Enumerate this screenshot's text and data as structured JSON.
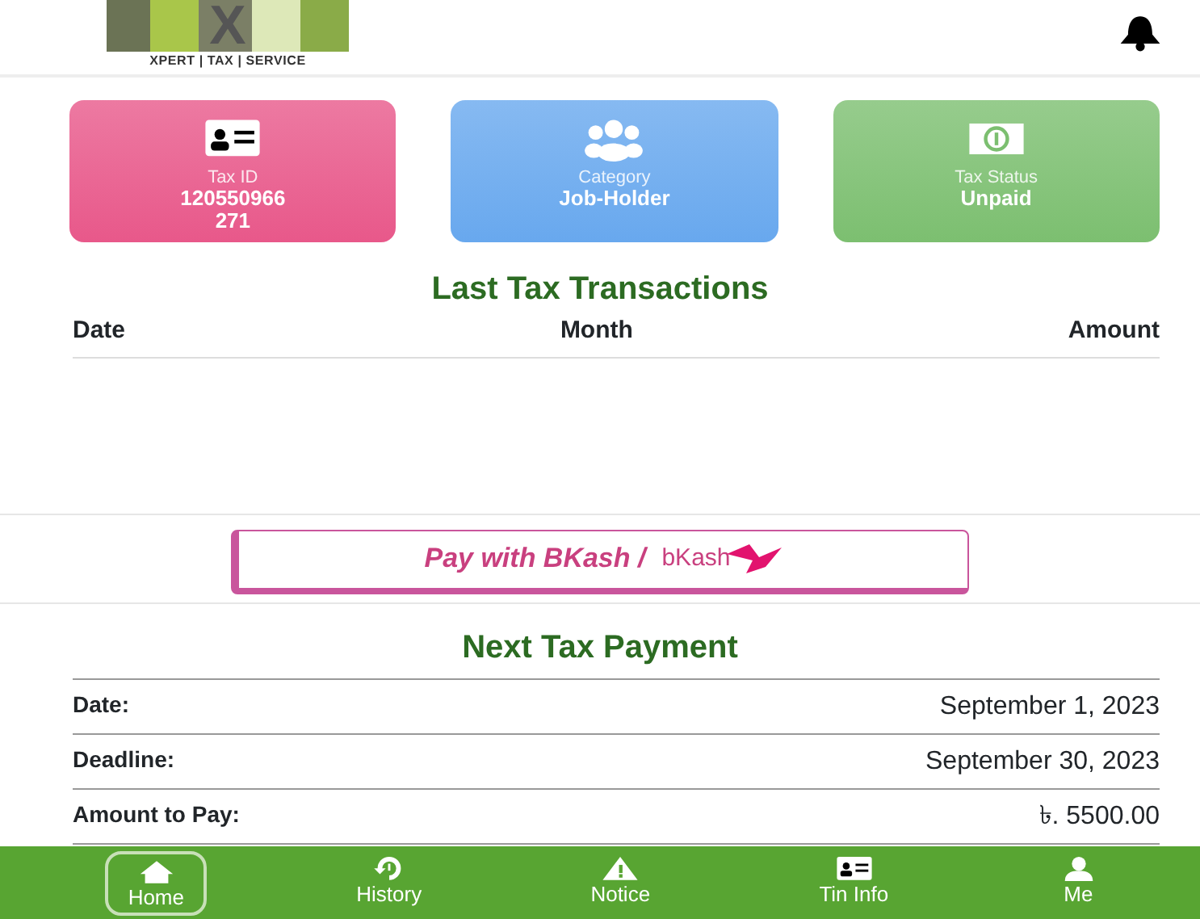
{
  "header": {
    "logo_mark": "X",
    "logo_text": "XPERT | TAX | SERVICE"
  },
  "cards": [
    {
      "kind": "id",
      "label": "Tax ID",
      "value": "120550966\n271",
      "color": "#e8588a"
    },
    {
      "kind": "group",
      "label": "Category",
      "value": "Job-Holder",
      "color": "#68a8ee"
    },
    {
      "kind": "money",
      "label": "Tax Status",
      "value": "Unpaid",
      "color": "#7cbf70"
    }
  ],
  "transactions": {
    "title": "Last Tax Transactions",
    "columns": [
      "Date",
      "Month",
      "Amount"
    ]
  },
  "pay_button": {
    "label": "Pay with BKash /",
    "brand": "bKash"
  },
  "next_payment": {
    "title": "Next Tax Payment",
    "rows": [
      {
        "label": "Date:",
        "value": "September 1, 2023"
      },
      {
        "label": "Deadline:",
        "value": "September 30, 2023"
      },
      {
        "label": "Amount to Pay:",
        "value": "৳. 5500.00"
      }
    ]
  },
  "nav": [
    {
      "kind": "home",
      "label": "Home",
      "selected": true
    },
    {
      "kind": "history",
      "label": "History",
      "selected": false
    },
    {
      "kind": "notice",
      "label": "Notice",
      "selected": false
    },
    {
      "kind": "id",
      "label": "Tin Info",
      "selected": false
    },
    {
      "kind": "person",
      "label": "Me",
      "selected": false
    }
  ]
}
